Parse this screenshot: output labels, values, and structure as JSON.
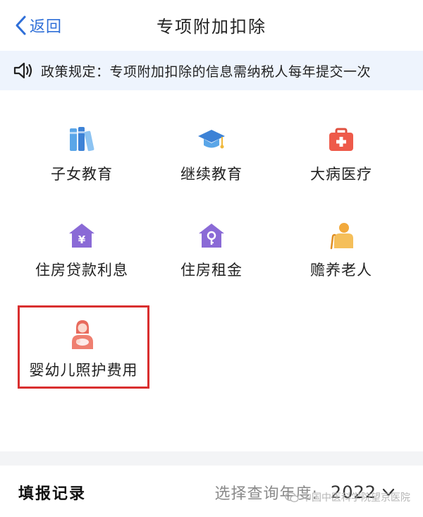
{
  "navbar": {
    "back_label": "返回",
    "title": "专项附加扣除"
  },
  "notice": {
    "text": "政策规定：专项附加扣除的信息需纳税人每年提交一次"
  },
  "deductions": [
    {
      "label": "子女教育",
      "icon": "books-icon"
    },
    {
      "label": "继续教育",
      "icon": "graduation-cap-icon"
    },
    {
      "label": "大病医疗",
      "icon": "medical-kit-icon"
    },
    {
      "label": "住房贷款利息",
      "icon": "house-yuan-icon"
    },
    {
      "label": "住房租金",
      "icon": "house-key-icon"
    },
    {
      "label": "赡养老人",
      "icon": "elderly-person-icon"
    },
    {
      "label": "婴幼儿照护费用",
      "icon": "mother-baby-icon"
    }
  ],
  "records": {
    "title": "填报记录",
    "year_label": "选择查询年度:",
    "year_value": "2022"
  },
  "watermark": {
    "text": "中国中医科学院望京医院"
  },
  "colors": {
    "accent_blue": "#2f6fd8",
    "notice_bg": "#eef4fd",
    "highlight_red": "#d92f2f"
  }
}
